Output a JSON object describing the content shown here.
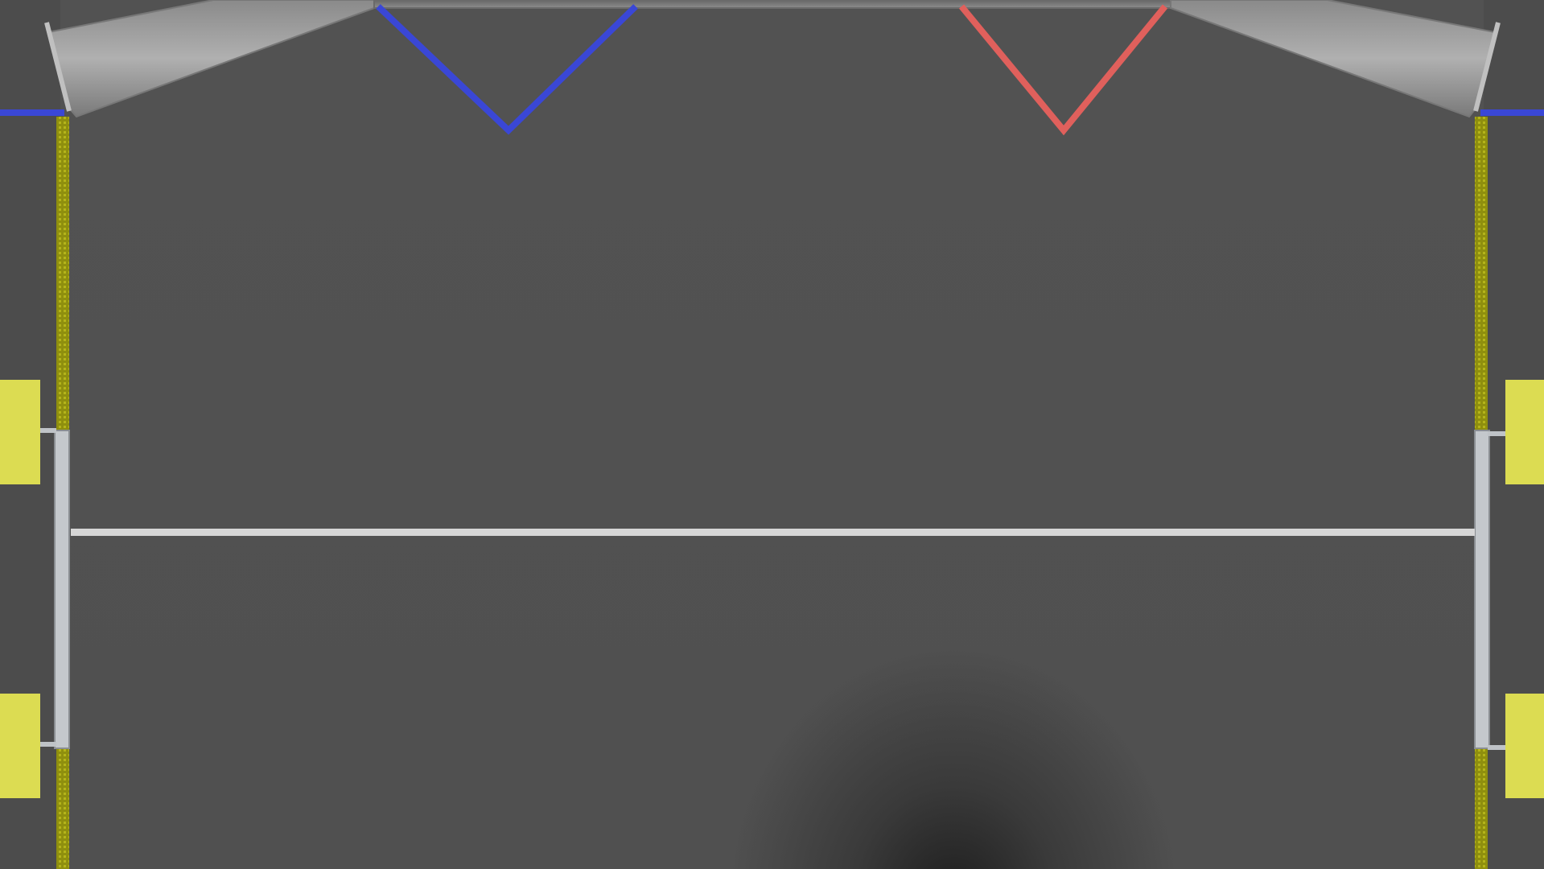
{
  "scene": {
    "view": "top-down field",
    "colors": {
      "floor": "#525252",
      "outside_floor": "#4c4c4c",
      "wall_panel": "#9a9a9a",
      "blue_tape": "#3a47d6",
      "red_tape": "#e0605c",
      "center_line": "#d6d6d6",
      "yellow_marker": "#dcdc52",
      "yellow_rail": "#9c9c10",
      "side_rail": "#c8ccd0"
    }
  }
}
